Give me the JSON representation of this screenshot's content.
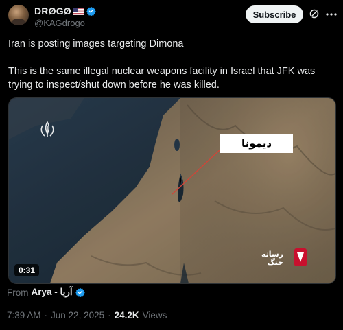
{
  "author": {
    "display_name": "DRØGØ",
    "handle": "@KAGdrogo",
    "flag_icon": "us-flag-icon",
    "verified_icon": "verified-badge-icon"
  },
  "actions": {
    "subscribe_label": "Subscribe",
    "grok_icon": "grok-icon",
    "more_icon": "more-options-icon"
  },
  "post": {
    "paragraphs": [
      "Iran is posting images targeting Dimona",
      "This is the same illegal nuclear weapons facility in Israel that JFK was trying to inspect/shut down before he was killed."
    ]
  },
  "media": {
    "duration": "0:31",
    "map_label": "ديمونا",
    "brand_line1": "رسانه",
    "brand_line2": "جنگ",
    "colors": {
      "sea": "#1d2f3d",
      "land": "#8f7a5e",
      "label_bg": "#ffffff"
    }
  },
  "source": {
    "from_label": "From",
    "name": "Arya - آریا"
  },
  "meta": {
    "time": "7:39 AM",
    "separator": "·",
    "date": "Jun 22, 2025",
    "views_count": "24.2K",
    "views_label": "Views"
  }
}
